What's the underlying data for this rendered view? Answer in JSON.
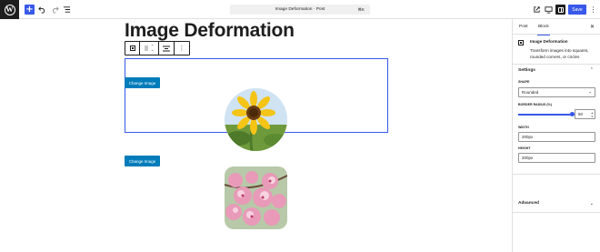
{
  "topbar": {
    "logo_letter": "W",
    "add_icon": "plus-icon",
    "undo_icon": "undo-icon",
    "redo_icon": "redo-icon",
    "list_view_icon": "list-view-icon",
    "document_title": "Image Deformation · Post",
    "shortcut": "⌘K",
    "save_label": "Save"
  },
  "editor": {
    "post_title": "Image Deformation",
    "blocks": [
      {
        "change_image_label": "Change Image",
        "shape": "circle"
      },
      {
        "change_image_label": "Change Image",
        "shape": "rounded"
      }
    ]
  },
  "sidebar": {
    "tabs": [
      {
        "label": "Post"
      },
      {
        "label": "Block"
      }
    ],
    "close_icon": "close-icon",
    "block_card": {
      "name": "Image Deformation",
      "description": "Transform images into squares, rounded corners, or circles"
    },
    "settings_panel": {
      "title": "Settings",
      "shape_label": "SHAPE",
      "shape_value": "Rounded",
      "border_radius_label": "BORDER RADIUS (%)",
      "border_radius_value": "50",
      "border_radius_fraction": 1.0,
      "width_label": "WIDTH",
      "width_value": "200px",
      "height_label": "HEIGHT",
      "height_value": "200px"
    },
    "advanced_panel": {
      "title": "Advanced"
    }
  },
  "colors": {
    "accent": "#3858e9",
    "button_blue": "#007cba",
    "dark": "#1e1e1e"
  }
}
